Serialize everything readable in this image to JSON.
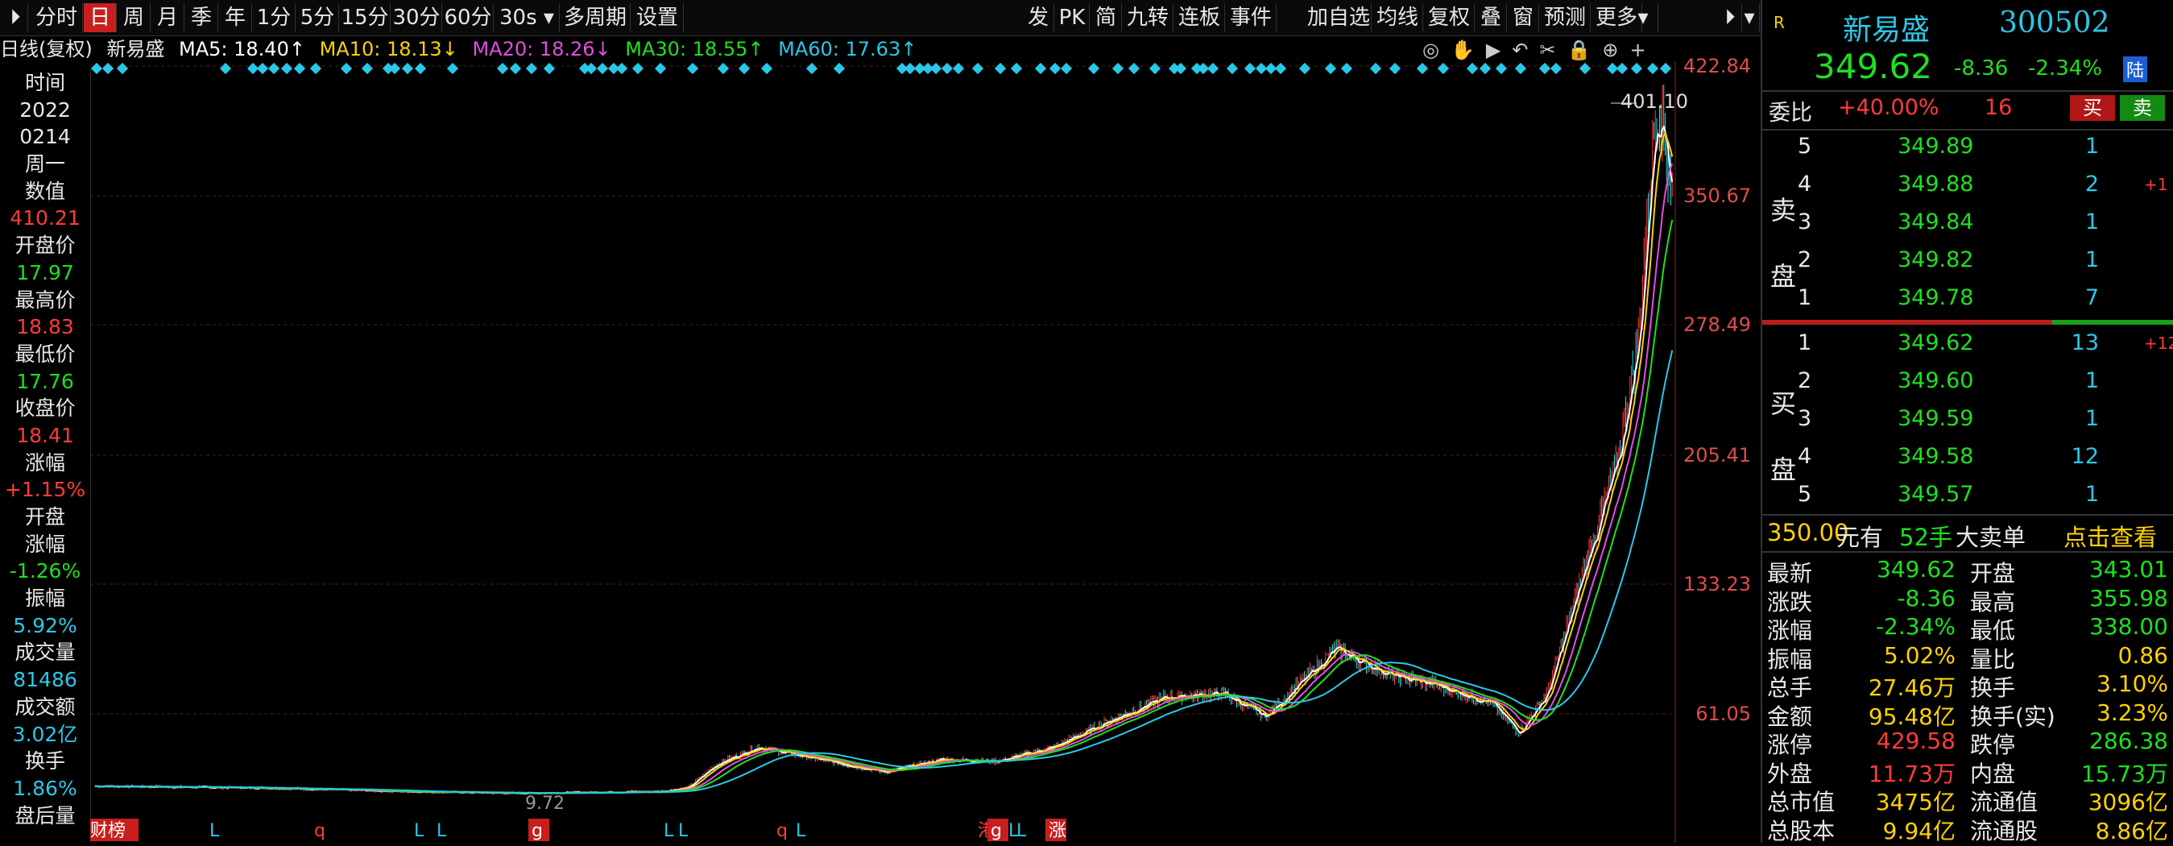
{
  "toolbar": {
    "left": [
      "分时",
      "日",
      "周",
      "月",
      "季",
      "年",
      "1分",
      "5分",
      "15分",
      "30分",
      "60分",
      "30s",
      "多周期",
      "设置"
    ],
    "right": [
      "发",
      "PK",
      "简",
      "九转",
      "连板",
      "事件",
      "加自选",
      "均线",
      "复权",
      "叠",
      "窗",
      "预测",
      "更多"
    ]
  },
  "ma": {
    "period": "日线(复权)",
    "name": "新易盛",
    "ma5": "MA5: 18.40↑",
    "ma10": "MA10: 18.13↓",
    "ma20": "MA20: 18.26↓",
    "ma30": "MA30: 18.55↑",
    "ma60": "MA60: 17.63↑"
  },
  "colors": {
    "ma5": "#ffffff",
    "ma10": "#ffd200",
    "ma20": "#e04fe0",
    "ma30": "#1ee01e",
    "ma60": "#2ac8e8",
    "up": "#ff3b3b",
    "down": "#2ad8d8"
  },
  "left_panel": [
    {
      "t": "时间",
      "c": "white"
    },
    {
      "t": "2022",
      "c": "white"
    },
    {
      "t": "0214",
      "c": "white"
    },
    {
      "t": "周一",
      "c": "white"
    },
    {
      "t": "数值",
      "c": "white"
    },
    {
      "t": "410.21",
      "c": "red"
    },
    {
      "t": "开盘价",
      "c": "white"
    },
    {
      "t": "17.97",
      "c": "green"
    },
    {
      "t": "最高价",
      "c": "white"
    },
    {
      "t": "18.83",
      "c": "red"
    },
    {
      "t": "最低价",
      "c": "white"
    },
    {
      "t": "17.76",
      "c": "green"
    },
    {
      "t": "收盘价",
      "c": "white"
    },
    {
      "t": "18.41",
      "c": "red"
    },
    {
      "t": "涨幅",
      "c": "white"
    },
    {
      "t": "+1.15%",
      "c": "red"
    },
    {
      "t": "开盘",
      "c": "white"
    },
    {
      "t": "涨幅",
      "c": "white"
    },
    {
      "t": "-1.26%",
      "c": "green"
    },
    {
      "t": "振幅",
      "c": "white"
    },
    {
      "t": "5.92%",
      "c": "cyan"
    },
    {
      "t": "成交量",
      "c": "white"
    },
    {
      "t": "81486",
      "c": "cyan"
    },
    {
      "t": "成交额",
      "c": "white"
    },
    {
      "t": "3.02亿",
      "c": "cyan"
    },
    {
      "t": "换手",
      "c": "white"
    },
    {
      "t": "1.86%",
      "c": "cyan"
    },
    {
      "t": "盘后量",
      "c": "white"
    }
  ],
  "yaxis": [
    "422.84",
    "350.67",
    "278.49",
    "205.41",
    "133.23",
    "61.05"
  ],
  "annotations": {
    "high": "401.10",
    "low": "9.72"
  },
  "markers": [
    "L",
    "q",
    "L",
    "L",
    "g",
    "L",
    "L",
    "q",
    "L",
    "港",
    "g",
    "L",
    "L",
    "涨",
    "财榜"
  ],
  "chart_data": {
    "type": "candlestick",
    "title": "新易盛 日线(复权)",
    "ylim": [
      9.72,
      422.84
    ],
    "yticks": [
      422.84,
      350.67,
      278.49,
      205.41,
      133.23,
      61.05
    ],
    "max_label": 401.1,
    "min_label": 9.72,
    "series_shape": [
      [
        0,
        18
      ],
      [
        120,
        17
      ],
      [
        220,
        15
      ],
      [
        300,
        14
      ],
      [
        400,
        15
      ],
      [
        420,
        17
      ],
      [
        440,
        30
      ],
      [
        470,
        40
      ],
      [
        520,
        32
      ],
      [
        560,
        26
      ],
      [
        600,
        33
      ],
      [
        640,
        32
      ],
      [
        680,
        40
      ],
      [
        720,
        55
      ],
      [
        760,
        68
      ],
      [
        800,
        70
      ],
      [
        830,
        57
      ],
      [
        880,
        95
      ],
      [
        920,
        80
      ],
      [
        950,
        75
      ],
      [
        990,
        65
      ],
      [
        1010,
        48
      ],
      [
        1030,
        70
      ],
      [
        1060,
        150
      ],
      [
        1080,
        200
      ],
      [
        1095,
        270
      ],
      [
        1105,
        380
      ],
      [
        1110,
        401
      ],
      [
        1120,
        345
      ]
    ]
  },
  "quote": {
    "logo": "R",
    "name": "新易盛",
    "code": "300502",
    "price": "349.62",
    "change": "-8.36",
    "pct": "-2.34%",
    "tag": "陆",
    "weibi_label": "委比",
    "weibi": "+40.00%",
    "weicha": "16",
    "buy_btn": "买",
    "sell_btn": "卖",
    "sell_label": "卖盘",
    "buy_label": "买盘",
    "asks": [
      {
        "lvl": "5",
        "p": "349.89",
        "v": "1",
        "d": ""
      },
      {
        "lvl": "4",
        "p": "349.88",
        "v": "2",
        "d": "+1"
      },
      {
        "lvl": "3",
        "p": "349.84",
        "v": "1",
        "d": ""
      },
      {
        "lvl": "2",
        "p": "349.82",
        "v": "1",
        "d": ""
      },
      {
        "lvl": "1",
        "p": "349.78",
        "v": "7",
        "d": ""
      }
    ],
    "bids": [
      {
        "lvl": "1",
        "p": "349.62",
        "v": "13",
        "d": "+12"
      },
      {
        "lvl": "2",
        "p": "349.60",
        "v": "1",
        "d": ""
      },
      {
        "lvl": "3",
        "p": "349.59",
        "v": "1",
        "d": ""
      },
      {
        "lvl": "4",
        "p": "349.58",
        "v": "12",
        "d": ""
      },
      {
        "lvl": "5",
        "p": "349.57",
        "v": "1",
        "d": ""
      }
    ],
    "big_order": {
      "price": "350.00",
      "unit": "元有",
      "lots": "52手",
      "type": "大卖单",
      "action": "点击查看"
    },
    "stats": [
      {
        "l": "最新",
        "v": "349.62",
        "c": "green",
        "l2": "开盘",
        "v2": "343.01",
        "c2": "green"
      },
      {
        "l": "涨跌",
        "v": "-8.36",
        "c": "green",
        "l2": "最高",
        "v2": "355.98",
        "c2": "green"
      },
      {
        "l": "涨幅",
        "v": "-2.34%",
        "c": "green",
        "l2": "最低",
        "v2": "338.00",
        "c2": "green"
      },
      {
        "l": "振幅",
        "v": "5.02%",
        "c": "yellow",
        "l2": "量比",
        "v2": "0.86",
        "c2": "yellow"
      },
      {
        "l": "总手",
        "v": "27.46万",
        "c": "yellow",
        "l2": "换手",
        "v2": "3.10%",
        "c2": "yellow"
      },
      {
        "l": "金额",
        "v": "95.48亿",
        "c": "yellow",
        "l2": "换手(实)",
        "v2": "3.23%",
        "c2": "yellow"
      },
      {
        "l": "涨停",
        "v": "429.58",
        "c": "red",
        "l2": "跌停",
        "v2": "286.38",
        "c2": "green"
      },
      {
        "l": "外盘",
        "v": "11.73万",
        "c": "red",
        "l2": "内盘",
        "v2": "15.73万",
        "c2": "green"
      },
      {
        "l": "总市值",
        "v": "3475亿",
        "c": "yellow",
        "l2": "流通值",
        "v2": "3096亿",
        "c2": "yellow"
      },
      {
        "l": "总股本",
        "v": "9.94亿",
        "c": "yellow",
        "l2": "流通股",
        "v2": "8.86亿",
        "c2": "yellow"
      }
    ]
  }
}
